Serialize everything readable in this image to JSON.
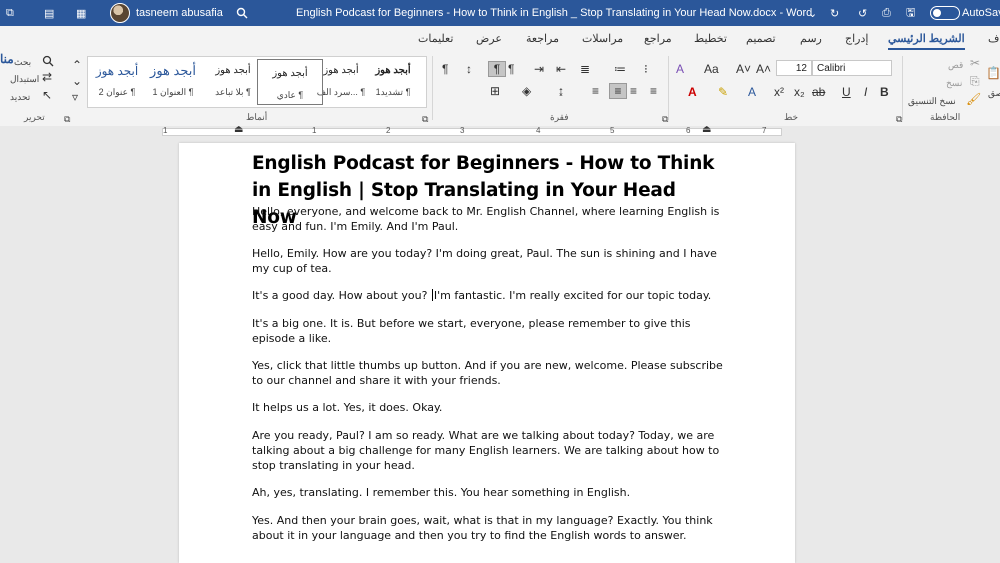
{
  "titlebar": {
    "user_name": "tasneem abusafia",
    "document_title": "English Podcast for Beginners - How to Think in English _ Stop Translating in Your Head Now.docx  -  Word",
    "autosave_label": "AutoSave",
    "autosave_state": "off"
  },
  "tabs": [
    {
      "label": "الشريط الرئيسي",
      "active": true
    },
    {
      "label": "إدراج"
    },
    {
      "label": "رسم"
    },
    {
      "label": "تصميم"
    },
    {
      "label": "تخطيط"
    },
    {
      "label": "مراجع"
    },
    {
      "label": "مراسلات"
    },
    {
      "label": "مراجعة"
    },
    {
      "label": "عرض"
    },
    {
      "label": "تعليمات"
    }
  ],
  "ribbon": {
    "clipboard": {
      "label": "الحافظة",
      "cut": "قص",
      "copy": "نسخ",
      "format_painter": "نسخ التنسيق",
      "paste": "لصق"
    },
    "font": {
      "label": "خط",
      "font_name": "Calibri",
      "font_size": "12"
    },
    "paragraph": {
      "label": "فقرة"
    },
    "styles": {
      "label": "أنماط",
      "items": [
        {
          "preview": "أبجد هوز",
          "name": "تشديد1 ¶"
        },
        {
          "preview": "أبجد هوز",
          "name": "سرد الف... ¶"
        },
        {
          "preview": "أبجد هوز",
          "name": "عادي ¶",
          "selected": true
        },
        {
          "preview": "أبجد هوز",
          "name": "بلا تباعد ¶"
        },
        {
          "preview": "أبجد هوز",
          "name": "العنوان 1 ¶"
        },
        {
          "preview": "أبجد هوز",
          "name": "عنوان 2 ¶"
        }
      ]
    },
    "editing": {
      "label": "تحرير",
      "find": "بحث",
      "replace": "استبدال",
      "select": "تحديد"
    },
    "left_stub": "منا"
  },
  "ruler": {
    "numbers": [
      "7",
      "6",
      "5",
      "4",
      "3",
      "2",
      "1",
      "1"
    ]
  },
  "document": {
    "title": "English Podcast for Beginners - How to Think in English | Stop Translating in Your Head Now",
    "paragraphs": [
      "Hello, everyone, and welcome back to Mr. English Channel, where learning English is easy and fun. I'm Emily. And I'm Paul.",
      "Hello, Emily. How are you today? I'm doing great, Paul. The sun is shining and I have my cup of tea.",
      "It's a good day. How about you? ",
      "I'm fantastic. I'm really excited for our topic today.",
      "It's a big one. It is. But before we start, everyone, please remember to give this episode a like.",
      "Yes, click that little thumbs up button. And if you are new, welcome. Please subscribe to our channel and share it with your friends.",
      "It helps us a lot. Yes, it does. Okay.",
      "Are you ready, Paul? I am so ready. What are we talking about today? Today, we are talking about a big challenge for many English learners. We are talking about how to stop translating in your head.",
      "Ah, yes, translating. I remember this. You hear something in English.",
      "Yes. And then your brain goes, wait, what is that in my language? Exactly. You think about it in your language and then you try to find the English words to answer."
    ]
  },
  "colors": {
    "accent": "#2b579a",
    "ribbon_bg": "#f3f3f3",
    "canvas_bg": "#e9e9e9"
  }
}
